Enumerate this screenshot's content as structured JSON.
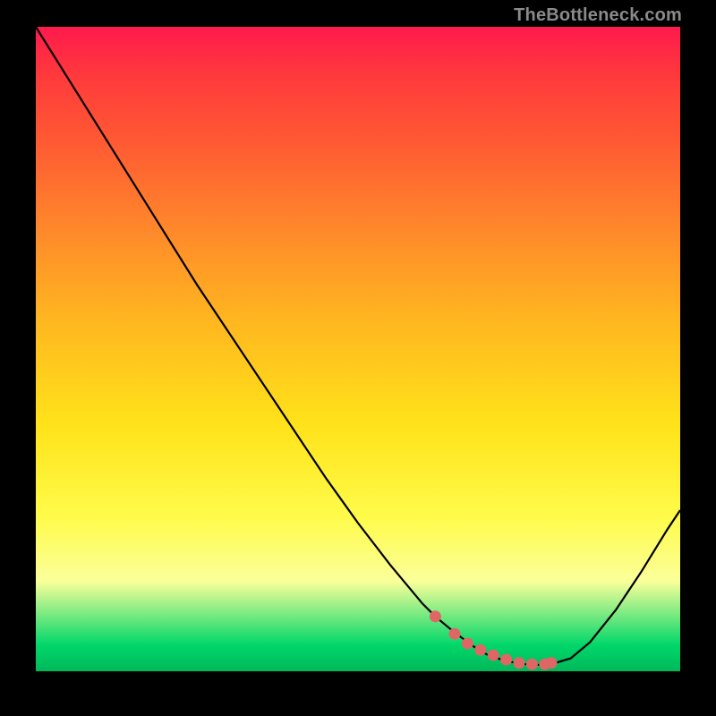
{
  "attribution": "TheBottleneck.com",
  "chart_data": {
    "type": "line",
    "title": "",
    "xlabel": "",
    "ylabel": "",
    "xlim": [
      0,
      100
    ],
    "ylim": [
      0,
      100
    ],
    "series": [
      {
        "name": "curve",
        "x": [
          0,
          5,
          10,
          15,
          20,
          25,
          30,
          35,
          40,
          45,
          50,
          55,
          60,
          62,
          65,
          68,
          70,
          72,
          74,
          76,
          78,
          80,
          83,
          86,
          90,
          94,
          98,
          100
        ],
        "values": [
          100,
          92,
          84,
          76,
          68,
          60,
          52.5,
          45,
          37.5,
          30,
          23,
          16.5,
          10.5,
          8.5,
          6,
          3.8,
          2.6,
          1.9,
          1.4,
          1.1,
          1.0,
          1.1,
          2.0,
          4.5,
          9.5,
          15.5,
          22,
          25
        ]
      }
    ],
    "markers": {
      "name": "dots",
      "x": [
        62,
        65,
        67,
        69,
        71,
        73,
        75,
        77,
        79,
        80
      ],
      "values": [
        8.5,
        5.8,
        4.3,
        3.3,
        2.5,
        1.8,
        1.3,
        1.1,
        1.1,
        1.3
      ]
    },
    "gradient_stops": [
      {
        "pos": 0,
        "color": "#ff1a4d"
      },
      {
        "pos": 8,
        "color": "#ff3b3b"
      },
      {
        "pos": 18,
        "color": "#ff5a33"
      },
      {
        "pos": 32,
        "color": "#ff8a2a"
      },
      {
        "pos": 46,
        "color": "#ffb81f"
      },
      {
        "pos": 62,
        "color": "#ffe31a"
      },
      {
        "pos": 76,
        "color": "#fffb4a"
      },
      {
        "pos": 86,
        "color": "#fbff9a"
      },
      {
        "pos": 96,
        "color": "#00d76a"
      },
      {
        "pos": 100,
        "color": "#00b85a"
      }
    ]
  }
}
